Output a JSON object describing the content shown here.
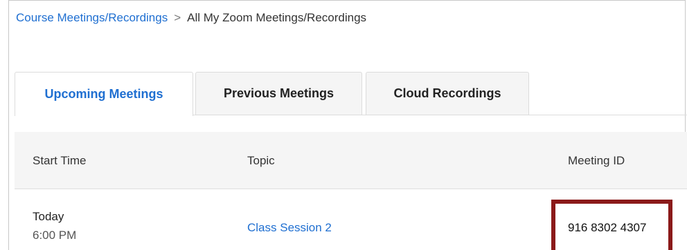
{
  "breadcrumb": {
    "parent_label": "Course Meetings/Recordings",
    "separator": ">",
    "current_label": "All My Zoom Meetings/Recordings"
  },
  "tabs": [
    {
      "label": "Upcoming Meetings",
      "active": true
    },
    {
      "label": "Previous Meetings",
      "active": false
    },
    {
      "label": "Cloud Recordings",
      "active": false
    }
  ],
  "table": {
    "columns": [
      "Start Time",
      "Topic",
      "Meeting ID"
    ],
    "rows": [
      {
        "day": "Today",
        "time": "6:00 PM",
        "topic": "Class Session 2",
        "meeting_id": "916 8302 4307"
      }
    ]
  },
  "colors": {
    "link": "#1f6fd1",
    "highlight_border": "#8b1a1a",
    "header_bg": "#f5f5f5"
  }
}
